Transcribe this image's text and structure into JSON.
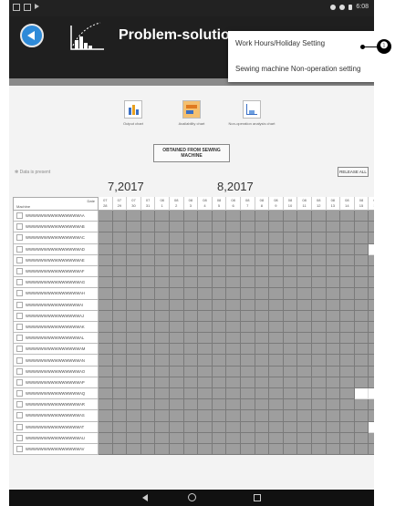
{
  "status_bar": {
    "time": "6:08"
  },
  "header": {
    "title": "Problem-solution"
  },
  "menu": {
    "items": [
      "Work Hours/Holiday Setting",
      "Sewing machine Non-operation setting"
    ]
  },
  "callout": {
    "number": "❶"
  },
  "charts": [
    {
      "label": "Output chart",
      "icon": "bar-chart-icon"
    },
    {
      "label": "Availability chart",
      "icon": "availability-chart-icon"
    },
    {
      "label": "Non-operation analysis chart",
      "icon": "line-chart-icon"
    }
  ],
  "buttons": {
    "obtain": "OBTAINED FROM SEWING MACHINE",
    "release_all": "RELEASE ALL"
  },
  "legend": "Data is present",
  "months": [
    "7,2017",
    "8,2017"
  ],
  "table": {
    "date_header": "Date",
    "machine_header": "Machine",
    "dates": [
      {
        "m": "07",
        "d": "28"
      },
      {
        "m": "07",
        "d": "29"
      },
      {
        "m": "07",
        "d": "30"
      },
      {
        "m": "07",
        "d": "31"
      },
      {
        "m": "08",
        "d": "1"
      },
      {
        "m": "08",
        "d": "2"
      },
      {
        "m": "08",
        "d": "3"
      },
      {
        "m": "08",
        "d": "4"
      },
      {
        "m": "08",
        "d": "5"
      },
      {
        "m": "08",
        "d": "6"
      },
      {
        "m": "08",
        "d": "7"
      },
      {
        "m": "08",
        "d": "8"
      },
      {
        "m": "08",
        "d": "9"
      },
      {
        "m": "08",
        "d": "10"
      },
      {
        "m": "08",
        "d": "11"
      },
      {
        "m": "08",
        "d": "12"
      },
      {
        "m": "08",
        "d": "13"
      },
      {
        "m": "08",
        "d": "14"
      },
      {
        "m": "08",
        "d": "15"
      },
      {
        "m": "08",
        "d": "16"
      },
      {
        "m": "08",
        "d": "17"
      }
    ],
    "rows": [
      {
        "name": "WWWWWWWWWWWWWWWAA",
        "white": []
      },
      {
        "name": "WWWWWWWWWWWWWWWAB",
        "white": []
      },
      {
        "name": "WWWWWWWWWWWWWWWAC",
        "white": []
      },
      {
        "name": "WWWWWWWWWWWWWWWAD",
        "white": [
          19,
          20
        ]
      },
      {
        "name": "WWWWWWWWWWWWWWWAE",
        "white": []
      },
      {
        "name": "WWWWWWWWWWWWWWWAF",
        "white": []
      },
      {
        "name": "WWWWWWWWWWWWWWWAG",
        "white": []
      },
      {
        "name": "WWWWWWWWWWWWWWWAH",
        "white": [
          20
        ]
      },
      {
        "name": "WWWWWWWWWWWWWWWAI",
        "white": []
      },
      {
        "name": "WWWWWWWWWWWWWWWAJ",
        "white": []
      },
      {
        "name": "WWWWWWWWWWWWWWWAK",
        "white": []
      },
      {
        "name": "WWWWWWWWWWWWWWWAL",
        "white": [
          20
        ]
      },
      {
        "name": "WWWWWWWWWWWWWWWAM",
        "white": []
      },
      {
        "name": "WWWWWWWWWWWWWWWAN",
        "white": []
      },
      {
        "name": "WWWWWWWWWWWWWWWAO",
        "white": []
      },
      {
        "name": "WWWWWWWWWWWWWWWAP",
        "white": []
      },
      {
        "name": "WWWWWWWWWWWWWWWAQ",
        "white": [
          18,
          19
        ]
      },
      {
        "name": "WWWWWWWWWWWWWWWAR",
        "white": [
          20
        ]
      },
      {
        "name": "WWWWWWWWWWWWWWWAS",
        "white": [
          20
        ]
      },
      {
        "name": "WWWWWWWWWWWWWWWAT",
        "white": [
          19
        ]
      },
      {
        "name": "WWWWWWWWWWWWWWWAU",
        "white": []
      },
      {
        "name": "WWWWWWWWWWWWWWWAV",
        "white": []
      }
    ]
  }
}
